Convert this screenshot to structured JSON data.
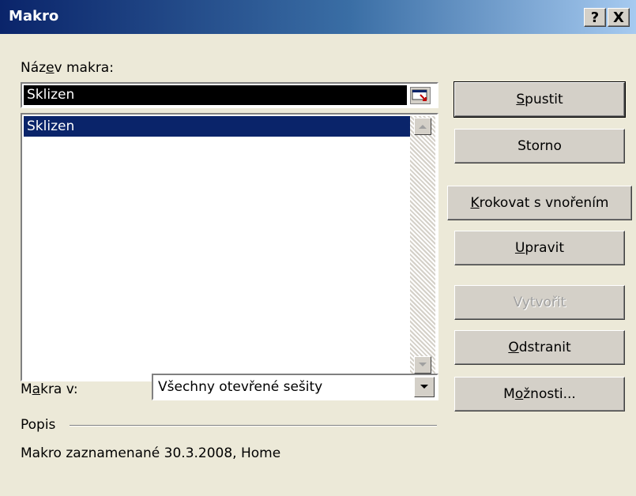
{
  "window": {
    "title": "Makro",
    "help_button": "?",
    "close_button": "X"
  },
  "macro_name": {
    "label_pre": "Náz",
    "label_mnemonic": "e",
    "label_post": "v makra:",
    "value": "Sklizen"
  },
  "macro_list": {
    "items": [
      "Sklizen"
    ]
  },
  "buttons": {
    "run": {
      "mnemonic": "S",
      "rest": "pustit"
    },
    "cancel": {
      "label": "Storno"
    },
    "step_into": {
      "mnemonic": "K",
      "rest": "rokovat s vnořením"
    },
    "edit": {
      "mnemonic": "U",
      "rest": "pravit"
    },
    "create": {
      "label": "Vytvořit"
    },
    "delete": {
      "mnemonic": "O",
      "rest": "dstranit"
    },
    "options": {
      "pre": "M",
      "mnemonic": "o",
      "rest": "žnosti..."
    }
  },
  "macros_in": {
    "label_pre": "M",
    "label_mnemonic": "a",
    "label_post": "kra v:",
    "selected": "Všechny otevřené sešity"
  },
  "description": {
    "heading": "Popis",
    "text": "Makro zaznamenané 30.3.2008, Home"
  },
  "colors": {
    "selection": "#0a246a",
    "titlebar_start": "#0a246a",
    "titlebar_end": "#a6caf0",
    "face": "#d4d0c8",
    "dialog_bg": "#ece9d8"
  }
}
